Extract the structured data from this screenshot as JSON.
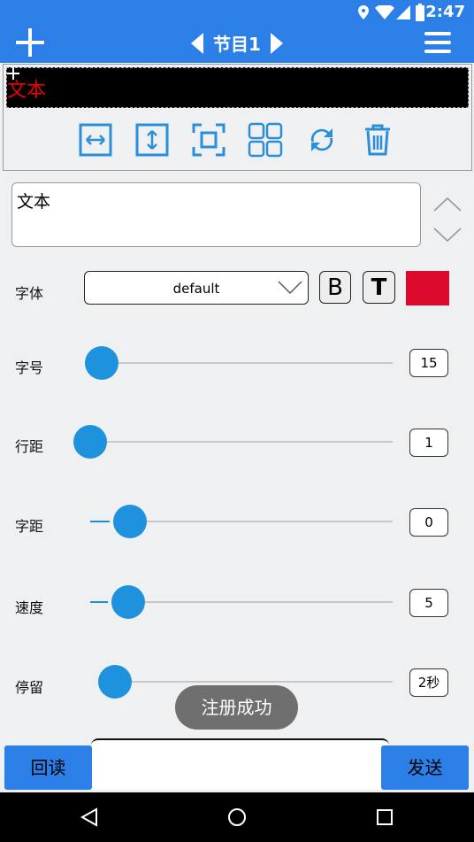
{
  "status_bar": {
    "time": "2:47"
  },
  "header": {
    "title": "节目1"
  },
  "preview": {
    "text": "文本"
  },
  "toolbar": {
    "icons": [
      "expand-horizontal-icon",
      "expand-vertical-icon",
      "fullscreen-icon",
      "grid-icon",
      "refresh-icon",
      "trash-icon"
    ]
  },
  "text_input": {
    "value": "文本"
  },
  "font": {
    "label": "字体",
    "value": "default",
    "bold_label": "B",
    "text_label": "T",
    "color": "#dc0b2e"
  },
  "sliders": [
    {
      "label": "字号",
      "value": "15"
    },
    {
      "label": "行距",
      "value": "1"
    },
    {
      "label": "字距",
      "value": "0"
    },
    {
      "label": "速度",
      "value": "5"
    },
    {
      "label": "停留",
      "value": "2秒"
    }
  ],
  "toast": {
    "text": "注册成功"
  },
  "buttons": {
    "read_back": "回读",
    "send": "发送"
  },
  "colors": {
    "accent": "#2b7fe6",
    "slider": "#1f92dd"
  }
}
